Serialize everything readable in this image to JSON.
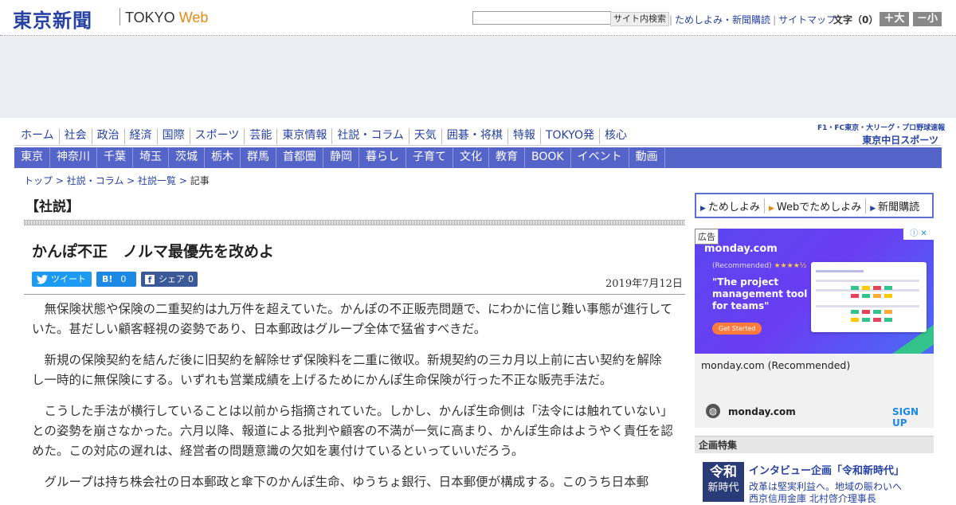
{
  "header": {
    "logo_jp": "東京新聞",
    "logo_tokyo": "TOKYO ",
    "logo_web": "Web",
    "search_placeholder": "",
    "search_button": "サイト内検索",
    "links": [
      "ためしよみ・新聞購読",
      "サイトマップ"
    ],
    "font_size_label": "文字（0）",
    "font_larger": "＋大",
    "font_smaller": "－小"
  },
  "nav_primary": [
    "ホーム",
    "社会",
    "政治",
    "経済",
    "国際",
    "スポーツ",
    "芸能",
    "東京情報",
    "社説・コラム",
    "天気",
    "囲碁・将棋",
    "特報",
    "TOKYO発",
    "核心"
  ],
  "sports_logo": {
    "top": "F1・FC東京・大リーグ・プロ野球速報",
    "bottom": "東京中日スポーツ"
  },
  "nav_regional": [
    "東京",
    "神奈川",
    "千葉",
    "埼玉",
    "茨城",
    "栃木",
    "群馬",
    "首都圏",
    "静岡",
    "暮らし",
    "子育て",
    "文化",
    "教育",
    "BOOK",
    "イベント",
    "動画"
  ],
  "breadcrumb": {
    "items": [
      "トップ",
      "社説・コラム",
      "社説一覧"
    ],
    "current": "記事"
  },
  "article": {
    "section": "【社説】",
    "headline": "かんぽ不正　ノルマ最優先を改めよ",
    "share": {
      "tweet": "ツイート",
      "hatena_label": "B!",
      "hatena_count": "0",
      "facebook_label": "シェア",
      "facebook_count": "0"
    },
    "date": "2019年7月12日",
    "paragraphs": [
      "無保険状態や保険の二重契約は九万件を超えていた。かんぽの不正販売問題で、にわかに信じ難い事態が進行していた。甚だしい顧客軽視の姿勢であり、日本郵政はグループ全体で猛省すべきだ。",
      "新規の保険契約を結んだ後に旧契約を解除せず保険料を二重に徴収。新規契約の三カ月以上前に古い契約を解除し一時的に無保険にする。いずれも営業成績を上げるためにかんぽ生命保険が行った不正な販売手法だ。",
      "こうした手法が横行していることは以前から指摘されていた。しかし、かんぽ生命側は「法令には触れていない」との姿勢を崩さなかった。六月以降、報道による批判や顧客の不満が一気に高まり、かんぽ生命はようやく責任を認めた。この対応の遅れは、経営者の問題意識の欠如を裏付けているといっていいだろう。",
      "グループは持ち株会社の日本郵政と傘下のかんぽ生命、ゆうちょ銀行、日本郵便が構成する。このうち日本郵"
    ]
  },
  "sidebar": {
    "links": [
      "ためしよみ",
      "Webでためしよみ",
      "新聞購読"
    ],
    "ad": {
      "tag": "広告",
      "brand": "monday.com",
      "recommended": "(Recommended)",
      "stars": "★★★★½",
      "quote": "\"The project management tool for teams\"",
      "cta": "Get Started",
      "caption": "monday.com (Recommended)",
      "domain": "monday.com",
      "signup": "SIGN UP"
    },
    "feature": {
      "header": "企画特集",
      "thumb_top": "令和",
      "thumb_bottom": "新時代",
      "title": "インタビュー企画「令和新時代」",
      "sub1": "改革は堅実利益へ。地域の賑わいへ",
      "sub2": "西京信用金庫 北村啓介理事長"
    }
  }
}
